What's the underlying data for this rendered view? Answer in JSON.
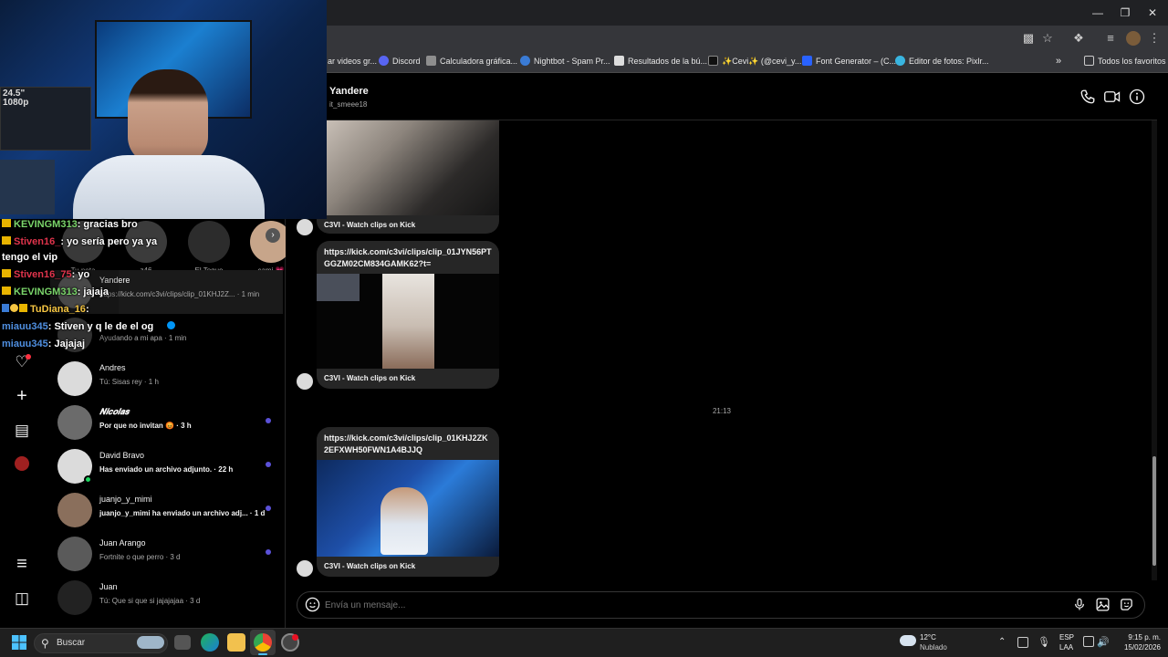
{
  "browser": {
    "bookmarks": [
      {
        "label": "ar videos gr...",
        "color": "#f0b400"
      },
      {
        "label": "Discord",
        "color": "#5865f2"
      },
      {
        "label": "Calculadora gráfica...",
        "color": "#8e8e8e"
      },
      {
        "label": "Nightbot - Spam Pr...",
        "color": "#3a7bd5"
      },
      {
        "label": "Resultados de la bú...",
        "color": "#dddddd"
      },
      {
        "label": "✨Cevi✨ (@cevi_y...",
        "color": "#111111"
      },
      {
        "label": "Font Generator – (C...",
        "color": "#2962ff"
      },
      {
        "label": "Editor de fotos: Pixlr...",
        "color": "#39b5e0"
      }
    ],
    "all_favorites": "Todos los favoritos"
  },
  "stream_chat": [
    {
      "user": "KEVINGM313",
      "text": ": gracias bro",
      "color": "#7bd66b"
    },
    {
      "user": "Stiven16_",
      "text": ": yo sería pero ya ya",
      "color": "#e0344c"
    },
    {
      "user": "",
      "text": "tengo el vip",
      "color": "#ffffff"
    },
    {
      "user": "Stiven16_75",
      "text": ": yo",
      "color": "#e0344c"
    },
    {
      "user": "KEVINGM313",
      "text": ": jajaja",
      "color": "#7bd66b"
    },
    {
      "user": "TuDiana_16",
      "text": ": ",
      "color": "#f5c542"
    },
    {
      "user": "miauu345",
      "text": ": Stiven y q le de el og",
      "color": "#4f8fe0"
    },
    {
      "user": "miauu345",
      "text": ": Jajajaj",
      "color": "#4f8fe0"
    }
  ],
  "notes": [
    {
      "label": "Tu nota"
    },
    {
      "label": "z46"
    },
    {
      "label": "El Toque"
    },
    {
      "label": "cami 💗"
    }
  ],
  "conversations": [
    {
      "name": "Yandere",
      "sub": "https://kick.com/c3vi/clips/clip_01KHJ2Z... · 1 min",
      "bold": false,
      "unread": false
    },
    {
      "name": "",
      "sub": "Ayudando a mi apa · 1 min",
      "bold": false,
      "unread": false
    },
    {
      "name": "Andres",
      "sub": "Tú: Sisas rey · 1 h",
      "bold": false,
      "unread": false
    },
    {
      "name": "𝑵𝒊𝒄𝒐𝒍𝒂𝒔",
      "sub": "Por que no invitan 😡 · 3 h",
      "bold": true,
      "unread": true
    },
    {
      "name": "David Bravo",
      "sub": "Has enviado un archivo adjunto. · 22 h",
      "bold": true,
      "unread": true
    },
    {
      "name": "juanjo_y_mimi",
      "sub": "juanjo_y_mimi ha enviado un archivo adj... · 1 d",
      "bold": true,
      "unread": true
    },
    {
      "name": "Juan Arango",
      "sub": "Fortnite o que perro · 3 d",
      "bold": false,
      "unread": true
    },
    {
      "name": "Juan",
      "sub": "Tú: Que si que si jajajajaa · 3 d",
      "bold": false,
      "unread": false
    }
  ],
  "chat": {
    "contact_name": "Yandere",
    "contact_handle": "it_smeee18",
    "time_divider": "21:13",
    "messages": [
      {
        "link": "",
        "footer": "C3VI - Watch clips on Kick"
      },
      {
        "link": "https://kick.com/c3vi/clips/clip_01JYN56PTGGZM02CM834GAMK62?t=",
        "footer": "C3VI - Watch clips on Kick"
      },
      {
        "link": "https://kick.com/c3vi/clips/clip_01KHJ2ZK2EFXWH50FWN1A4BJJQ",
        "footer": "C3VI - Watch clips on Kick"
      }
    ],
    "composer_placeholder": "Envía un mensaje..."
  },
  "taskbar": {
    "search_label": "Buscar",
    "weather_temp": "12°C",
    "weather_desc": "Nublado",
    "lang_top": "ESP",
    "lang_bottom": "LAA",
    "time": "9:15 p. m.",
    "date": "15/02/2026"
  }
}
